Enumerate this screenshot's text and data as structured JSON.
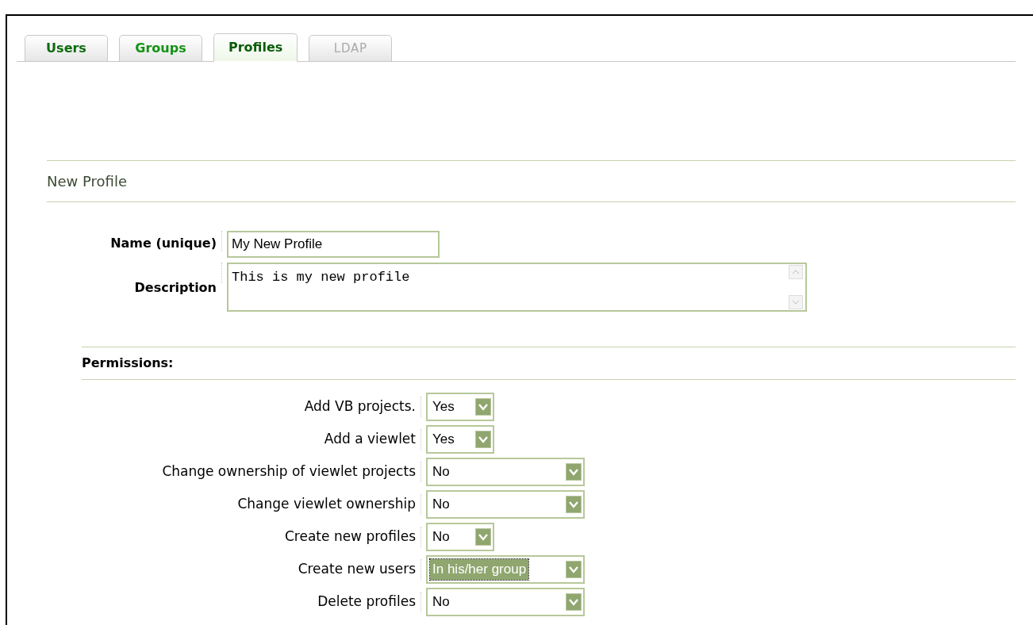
{
  "tabs": [
    {
      "label": "Users",
      "selected": false,
      "disabled": false
    },
    {
      "label": "Groups",
      "selected": false,
      "disabled": false
    },
    {
      "label": "Profiles",
      "selected": true,
      "disabled": false
    },
    {
      "label": "LDAP",
      "selected": false,
      "disabled": true
    }
  ],
  "section_title": "New Profile",
  "fields": [
    {
      "label": "Name (unique)",
      "kind": "input",
      "value": "My New Profile"
    },
    {
      "label": "Description",
      "kind": "textarea",
      "value": "This is my new profile"
    }
  ],
  "permissions": {
    "title": "Permissions:",
    "rows": [
      {
        "label": "Add VB projects.",
        "value": "Yes",
        "kind": "short",
        "focused": false
      },
      {
        "label": "Add a viewlet",
        "value": "Yes",
        "kind": "short",
        "focused": false
      },
      {
        "label": "Change ownership of viewlet projects",
        "value": "No",
        "kind": "long",
        "focused": false
      },
      {
        "label": "Change viewlet ownership",
        "value": "No",
        "kind": "long",
        "focused": false
      },
      {
        "label": "Create new profiles",
        "value": "No",
        "kind": "short",
        "focused": false
      },
      {
        "label": "Create new users",
        "value": "In his/her group",
        "kind": "long",
        "focused": true
      },
      {
        "label": "Delete profiles",
        "value": "No",
        "kind": "long",
        "focused": false
      }
    ]
  }
}
